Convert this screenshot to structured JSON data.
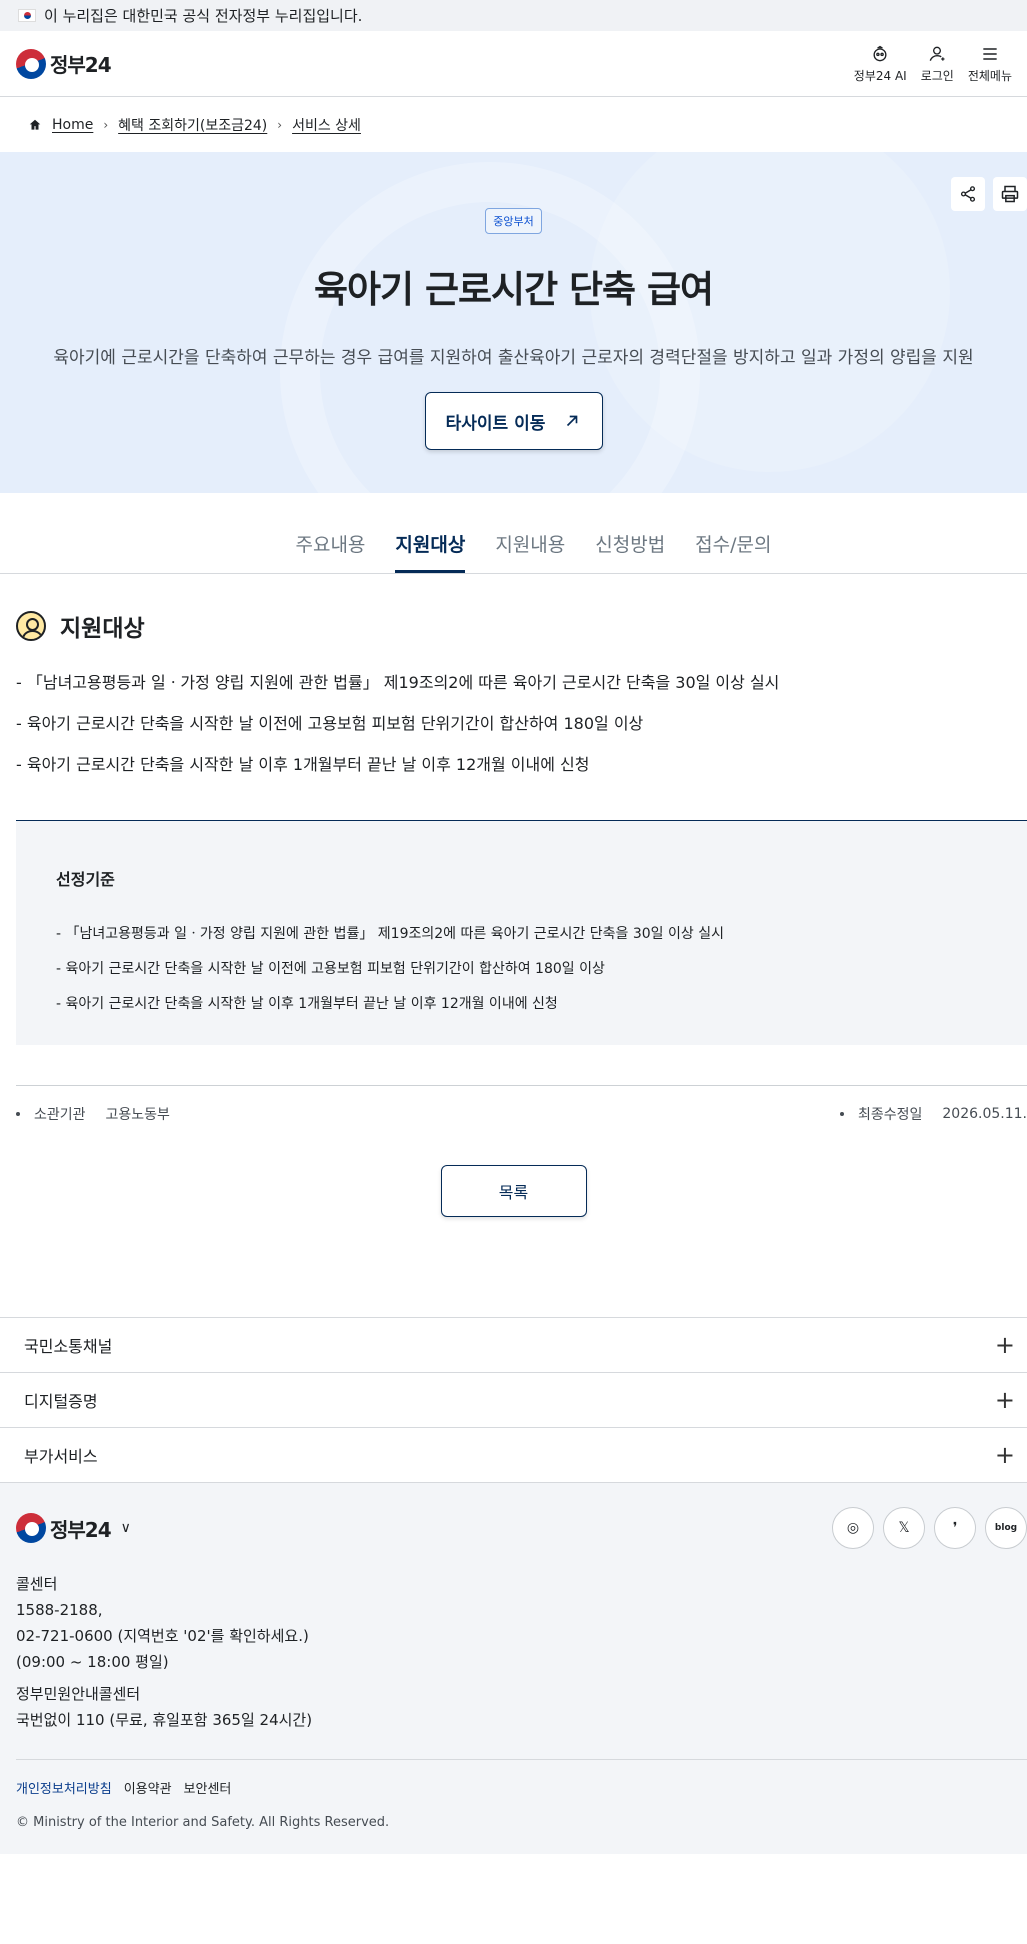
{
  "gov_banner": {
    "text": "이 누리집은 대한민국 공식 전자정부 누리집입니다."
  },
  "header": {
    "logo_text": "정부24",
    "actions": [
      {
        "label": "정부24 AI",
        "icon": "ai-robot-icon"
      },
      {
        "label": "로그인",
        "icon": "user-icon"
      },
      {
        "label": "전체메뉴",
        "icon": "hamburger-menu-icon"
      }
    ]
  },
  "breadcrumb": {
    "home": "Home",
    "items": [
      "혜택 조회하기(보조금24)",
      "서비스 상세"
    ]
  },
  "hero": {
    "badge": "중앙부처",
    "title": "육아기 근로시간 단축 급여",
    "description": "육아기에 근로시간을 단축하여 근무하는 경우 급여를 지원하여 출산육아기 근로자의 경력단절을 방지하고 일과 가정의 양립을 지원",
    "external_button": "타사이트 이동"
  },
  "tabs": [
    "주요내용",
    "지원대상",
    "지원내용",
    "신청방법",
    "접수/문의"
  ],
  "active_tab": "지원대상",
  "section": {
    "title": "지원대상",
    "items": [
      "- 「남녀고용평등과 일ㆍ가정 양립 지원에 관한 법률」 제19조의2에 따른 육아기 근로시간 단축을 30일 이상 실시",
      "- 육아기 근로시간 단축을 시작한 날 이전에 고용보험 피보험 단위기간이 합산하여 180일 이상",
      "- 육아기 근로시간 단축을 시작한 날 이후 1개월부터 끝난 날 이후 12개월 이내에 신청"
    ]
  },
  "selection": {
    "title": "선정기준",
    "items": [
      "- 「남녀고용평등과 일ㆍ가정 양립 지원에 관한 법률」 제19조의2에 따른 육아기 근로시간 단축을 30일 이상 실시",
      "- 육아기 근로시간 단축을 시작한 날 이전에 고용보험 피보험 단위기간이 합산하여 180일 이상",
      "- 육아기 근로시간 단축을 시작한 날 이후 1개월부터 끝난 날 이후 12개월 이내에 신청"
    ]
  },
  "meta": {
    "agency_label": "소관기관",
    "agency_value": "고용노동부",
    "modified_label": "최종수정일",
    "modified_value": "2026.05.11."
  },
  "list_button": "목록",
  "accordion": [
    "국민소통채널",
    "디지털증명",
    "부가서비스"
  ],
  "footer": {
    "logo_text": "정부24",
    "social": [
      {
        "icon": "instagram-icon",
        "glyph": "◎"
      },
      {
        "icon": "x-twitter-icon",
        "glyph": "𝕏"
      },
      {
        "icon": "kakao-story-icon",
        "glyph": "❜"
      },
      {
        "icon": "blog-icon",
        "glyph": "blog"
      }
    ],
    "call_center_label": "콜센터",
    "call_numbers": [
      "1588-2188,",
      "02-721-0600 (지역번호 '02'를 확인하세요.)",
      "(09:00 ~ 18:00 평일)"
    ],
    "civil_label": "정부민원안내콜센터",
    "civil_number": "국번없이 110 (무료, 휴일포함 365일 24시간)",
    "links": [
      "개인정보처리방침",
      "이용약관",
      "보안센터"
    ],
    "copyright": "© Ministry of the Interior and Safety. All Rights Reserved."
  },
  "colors": {
    "primary": "#052b57",
    "hero_bg": "#e5eefb",
    "accent_red": "#cd2e3a",
    "accent_blue": "#0047a0"
  }
}
